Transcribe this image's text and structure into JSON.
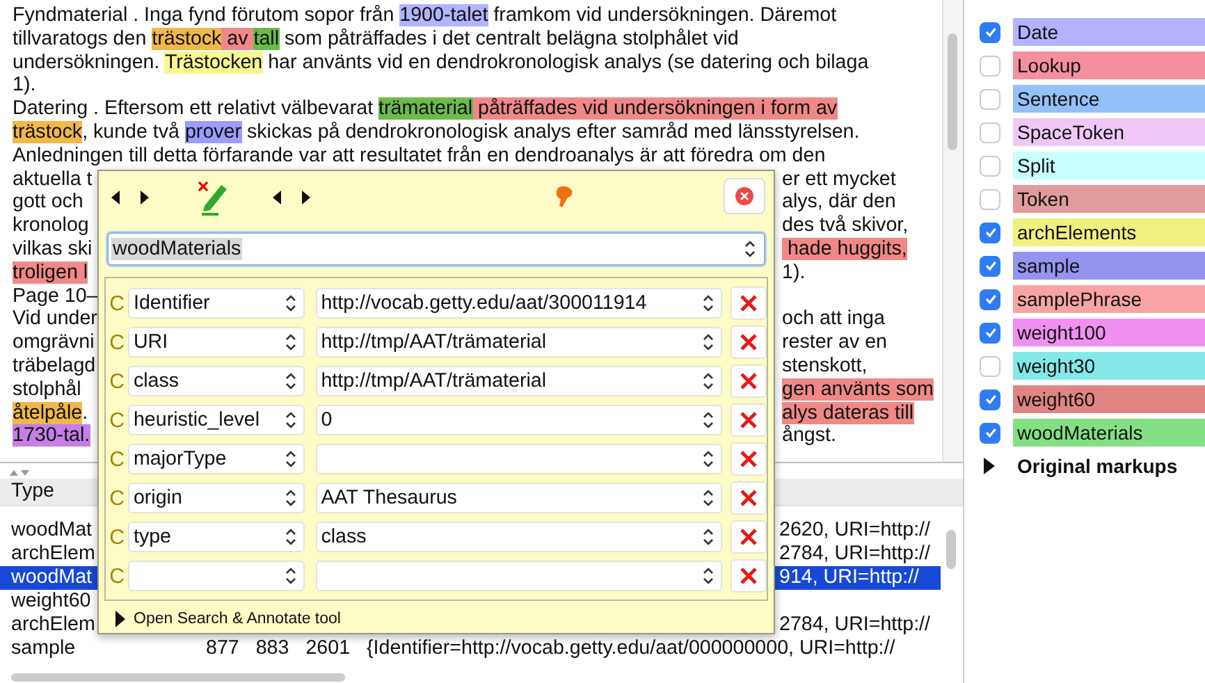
{
  "document": {
    "lines": [
      {
        "segments": [
          {
            "text": "Fyndmaterial . Inga fynd förutom sopor från "
          },
          {
            "text": "1900-talet",
            "color": "#b3b3ff"
          },
          {
            "text": " framkom vid undersökningen. Däremot"
          }
        ]
      },
      {
        "segments": [
          {
            "text": "tillvaratogs den "
          },
          {
            "text": "trästock",
            "color": "#f0b848"
          },
          {
            "text": " av ",
            "color": "#f08888"
          },
          {
            "text": "tall",
            "color": "#6cbb48"
          },
          {
            "text": " som påträffades i det centralt belägna stolphålet vid"
          }
        ]
      },
      {
        "segments": [
          {
            "text": "undersökningen. "
          },
          {
            "text": "Trästocken",
            "color": "#f8f890"
          },
          {
            "text": " har använts vid en dendrokronologisk analys (se datering och bilaga"
          }
        ]
      },
      {
        "segments": [
          {
            "text": "1)."
          }
        ]
      },
      {
        "segments": [
          {
            "text": "Datering . Eftersom ett relativt välbevarat "
          },
          {
            "text": "trämaterial",
            "color": "#6cbb48"
          },
          {
            "text": " påträffades vid undersökningen i form av",
            "color": "#f08888"
          }
        ]
      },
      {
        "segments": [
          {
            "text": "trästock",
            "color": "#f0b848"
          },
          {
            "text": ", kunde två "
          },
          {
            "text": "prover",
            "color": "#9c9cff"
          },
          {
            "text": " skickas på dendrokronologisk analys efter samråd med länsstyrelsen."
          }
        ]
      },
      {
        "segments": [
          {
            "text": "Anledningen till detta förfarande var att resultatet från en dendroanalys är att föredra om den"
          }
        ]
      },
      {
        "left": [
          {
            "text": "aktuella t"
          }
        ],
        "right": [
          {
            "text": "er ett mycket"
          }
        ]
      },
      {
        "left": [
          {
            "text": "gott och"
          }
        ],
        "right": [
          {
            "text": "alys, där den"
          }
        ]
      },
      {
        "left": [
          {
            "text": "kronolog"
          }
        ],
        "right": [
          {
            "text": "des två skivor,"
          }
        ]
      },
      {
        "left": [
          {
            "text": "vilkas ski"
          }
        ],
        "right": [
          {
            "text": " hade huggits,",
            "color": "#f08888"
          }
        ]
      },
      {
        "left": [
          {
            "text": "troligen l",
            "color": "#f08888"
          }
        ],
        "right": [
          {
            "text": "1)."
          }
        ]
      },
      {
        "left": [
          {
            "text": "Page 10–"
          }
        ]
      },
      {
        "left": [
          {
            "text": "Vid under"
          }
        ],
        "right": [
          {
            "text": "och att inga"
          }
        ]
      },
      {
        "left": [
          {
            "text": "omgrävni"
          }
        ],
        "right": [
          {
            "text": "rester av en"
          }
        ]
      },
      {
        "left": [
          {
            "text": "träbelagd"
          }
        ],
        "right": [
          {
            "text": "stenskott,"
          }
        ]
      },
      {
        "left": [
          {
            "text": "stolphål"
          }
        ],
        "right": [
          {
            "text": "gen använts som",
            "color": "#f08888"
          }
        ]
      },
      {
        "left": [
          {
            "text": "åtelpåle",
            "color": "#f0b848"
          },
          {
            "text": "."
          }
        ],
        "right": [
          {
            "text": "alys dateras till",
            "color": "#f08888"
          }
        ]
      },
      {
        "left": [
          {
            "text": "1730-tal.",
            "color": "#c47ee4"
          }
        ],
        "right": [
          {
            "text": "ångst."
          }
        ]
      }
    ]
  },
  "annotation_editor": {
    "type": "woodMaterials",
    "features": [
      {
        "marker": "C",
        "name": "Identifier",
        "value": "http://vocab.getty.edu/aat/300011914"
      },
      {
        "marker": "C",
        "name": "URI",
        "value": "http://tmp/AAT/trämaterial"
      },
      {
        "marker": "C",
        "name": "class",
        "value": "http://tmp/AAT/trämaterial"
      },
      {
        "marker": "C",
        "name": "heuristic_level",
        "value": "0"
      },
      {
        "marker": "C",
        "name": "majorType"
      },
      {
        "marker": "C",
        "name": "origin",
        "value": "AAT Thesaurus"
      },
      {
        "marker": "C",
        "name": "type",
        "value": "class"
      },
      {
        "marker": "C"
      }
    ],
    "footer_link": "Open Search & Annotate tool"
  },
  "annotation_list": {
    "columns": [
      "Type"
    ],
    "rows": [
      {
        "type": "woodMat",
        "tail": "2620, URI=http://",
        "selected": false
      },
      {
        "type": "archElem",
        "tail": "2784, URI=http://",
        "selected": false
      },
      {
        "type": "woodMat",
        "tail": "914, URI=http://",
        "selected": true
      },
      {
        "type": "weight60",
        "selected": false
      },
      {
        "type": "archElem",
        "tail": "2784, URI=http://",
        "selected": false
      },
      {
        "type": "sample",
        "start": "877",
        "end": "883",
        "id": "2601",
        "features": "{Identifier=http://vocab.getty.edu/aat/000000000, URI=http://",
        "selected": false
      }
    ]
  },
  "annotation_sets": {
    "types": [
      {
        "label": "Date",
        "checked": true,
        "color": "#b3b3ff"
      },
      {
        "label": "Lookup",
        "checked": false,
        "color": "#f58fa0"
      },
      {
        "label": "Sentence",
        "checked": false,
        "color": "#94c0f8"
      },
      {
        "label": "SpaceToken",
        "checked": false,
        "color": "#f0c8f8"
      },
      {
        "label": "Split",
        "checked": false,
        "color": "#c8ffff"
      },
      {
        "label": "Token",
        "checked": false,
        "color": "#e09c9c"
      },
      {
        "label": "archElements",
        "checked": true,
        "color": "#f0f080"
      },
      {
        "label": "sample",
        "checked": true,
        "color": "#9494f0"
      },
      {
        "label": "samplePhrase",
        "checked": true,
        "color": "#f8a4a4"
      },
      {
        "label": "weight100",
        "checked": true,
        "color": "#f090f0"
      },
      {
        "label": "weight30",
        "checked": false,
        "color": "#84e8e8"
      },
      {
        "label": "weight60",
        "checked": true,
        "color": "#e08484"
      },
      {
        "label": "woodMaterials",
        "checked": true,
        "color": "#84e084"
      }
    ],
    "group": {
      "label": "Original markups",
      "expanded": false
    }
  }
}
